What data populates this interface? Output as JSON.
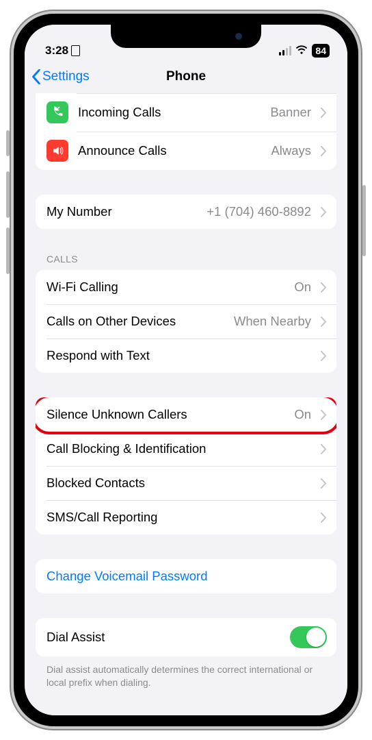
{
  "status": {
    "time": "3:28",
    "battery": "84"
  },
  "nav": {
    "back": "Settings",
    "title": "Phone"
  },
  "rows": {
    "incoming": {
      "label": "Incoming Calls",
      "value": "Banner"
    },
    "announce": {
      "label": "Announce Calls",
      "value": "Always"
    },
    "mynumber": {
      "label": "My Number",
      "value": "+1 (704) 460-8892"
    },
    "wifi": {
      "label": "Wi-Fi Calling",
      "value": "On"
    },
    "other": {
      "label": "Calls on Other Devices",
      "value": "When Nearby"
    },
    "respond": {
      "label": "Respond with Text"
    },
    "silence": {
      "label": "Silence Unknown Callers",
      "value": "On"
    },
    "blockid": {
      "label": "Call Blocking & Identification"
    },
    "blocked": {
      "label": "Blocked Contacts"
    },
    "sms": {
      "label": "SMS/Call Reporting"
    },
    "voicemail": {
      "label": "Change Voicemail Password"
    },
    "dial": {
      "label": "Dial Assist"
    }
  },
  "sections": {
    "calls": "Calls"
  },
  "footer": {
    "dial": "Dial assist automatically determines the correct international or local prefix when dialing."
  },
  "colors": {
    "accent": "#007aff",
    "green": "#34c759",
    "red": "#ff3b30",
    "highlight": "#e2000f"
  }
}
